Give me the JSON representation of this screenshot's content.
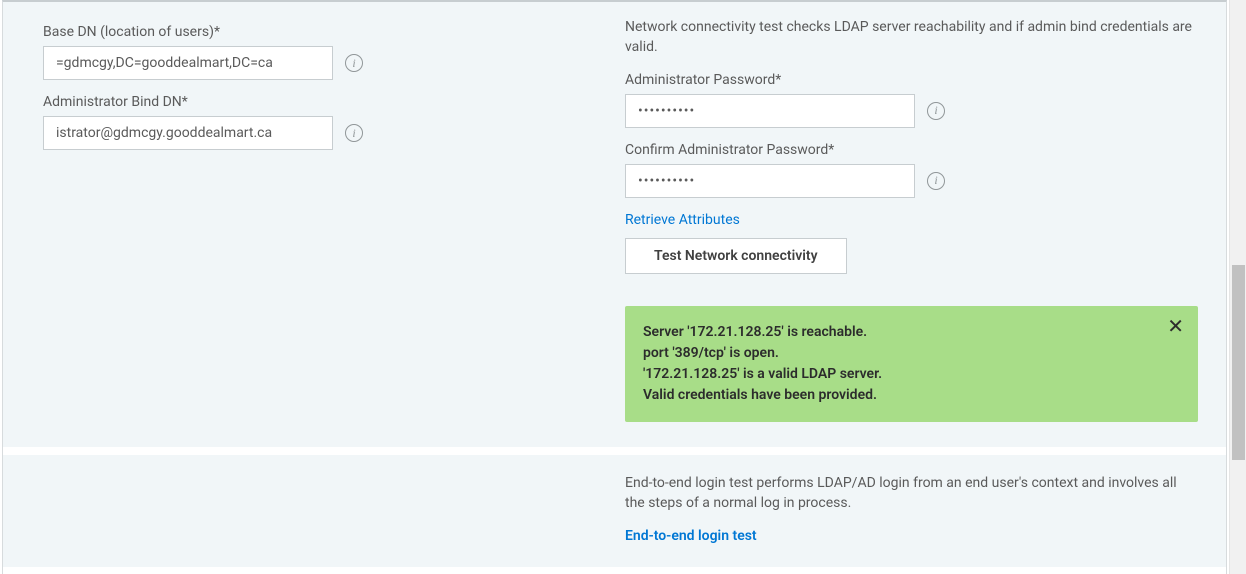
{
  "left_panel": {
    "base_dn_label": "Base DN (location of users)*",
    "base_dn_value": "=gdmcgy,DC=gooddealmart,DC=ca",
    "admin_bind_label": "Administrator Bind DN*",
    "admin_bind_value": "istrator@gdmcgy.gooddealmart.ca"
  },
  "right_panel": {
    "connectivity_desc": "Network connectivity test checks LDAP server reachability and if admin bind credentials are valid.",
    "admin_pw_label": "Administrator Password*",
    "admin_pw_value": "••••••••••",
    "confirm_pw_label": "Confirm Administrator Password*",
    "confirm_pw_value": "••••••••••",
    "retrieve_link": "Retrieve Attributes",
    "test_btn": "Test Network connectivity",
    "success": {
      "line1": "Server '172.21.128.25' is reachable.",
      "line2": "port '389/tcp' is open.",
      "line3": "'172.21.128.25' is a valid LDAP server.",
      "line4": "Valid credentials have been provided."
    }
  },
  "bottom_panel": {
    "e2e_desc": "End-to-end login test performs LDAP/AD login from an end user's context and involves all the steps of a normal log in process.",
    "e2e_link": "End-to-end login test"
  },
  "info_glyph": "i"
}
